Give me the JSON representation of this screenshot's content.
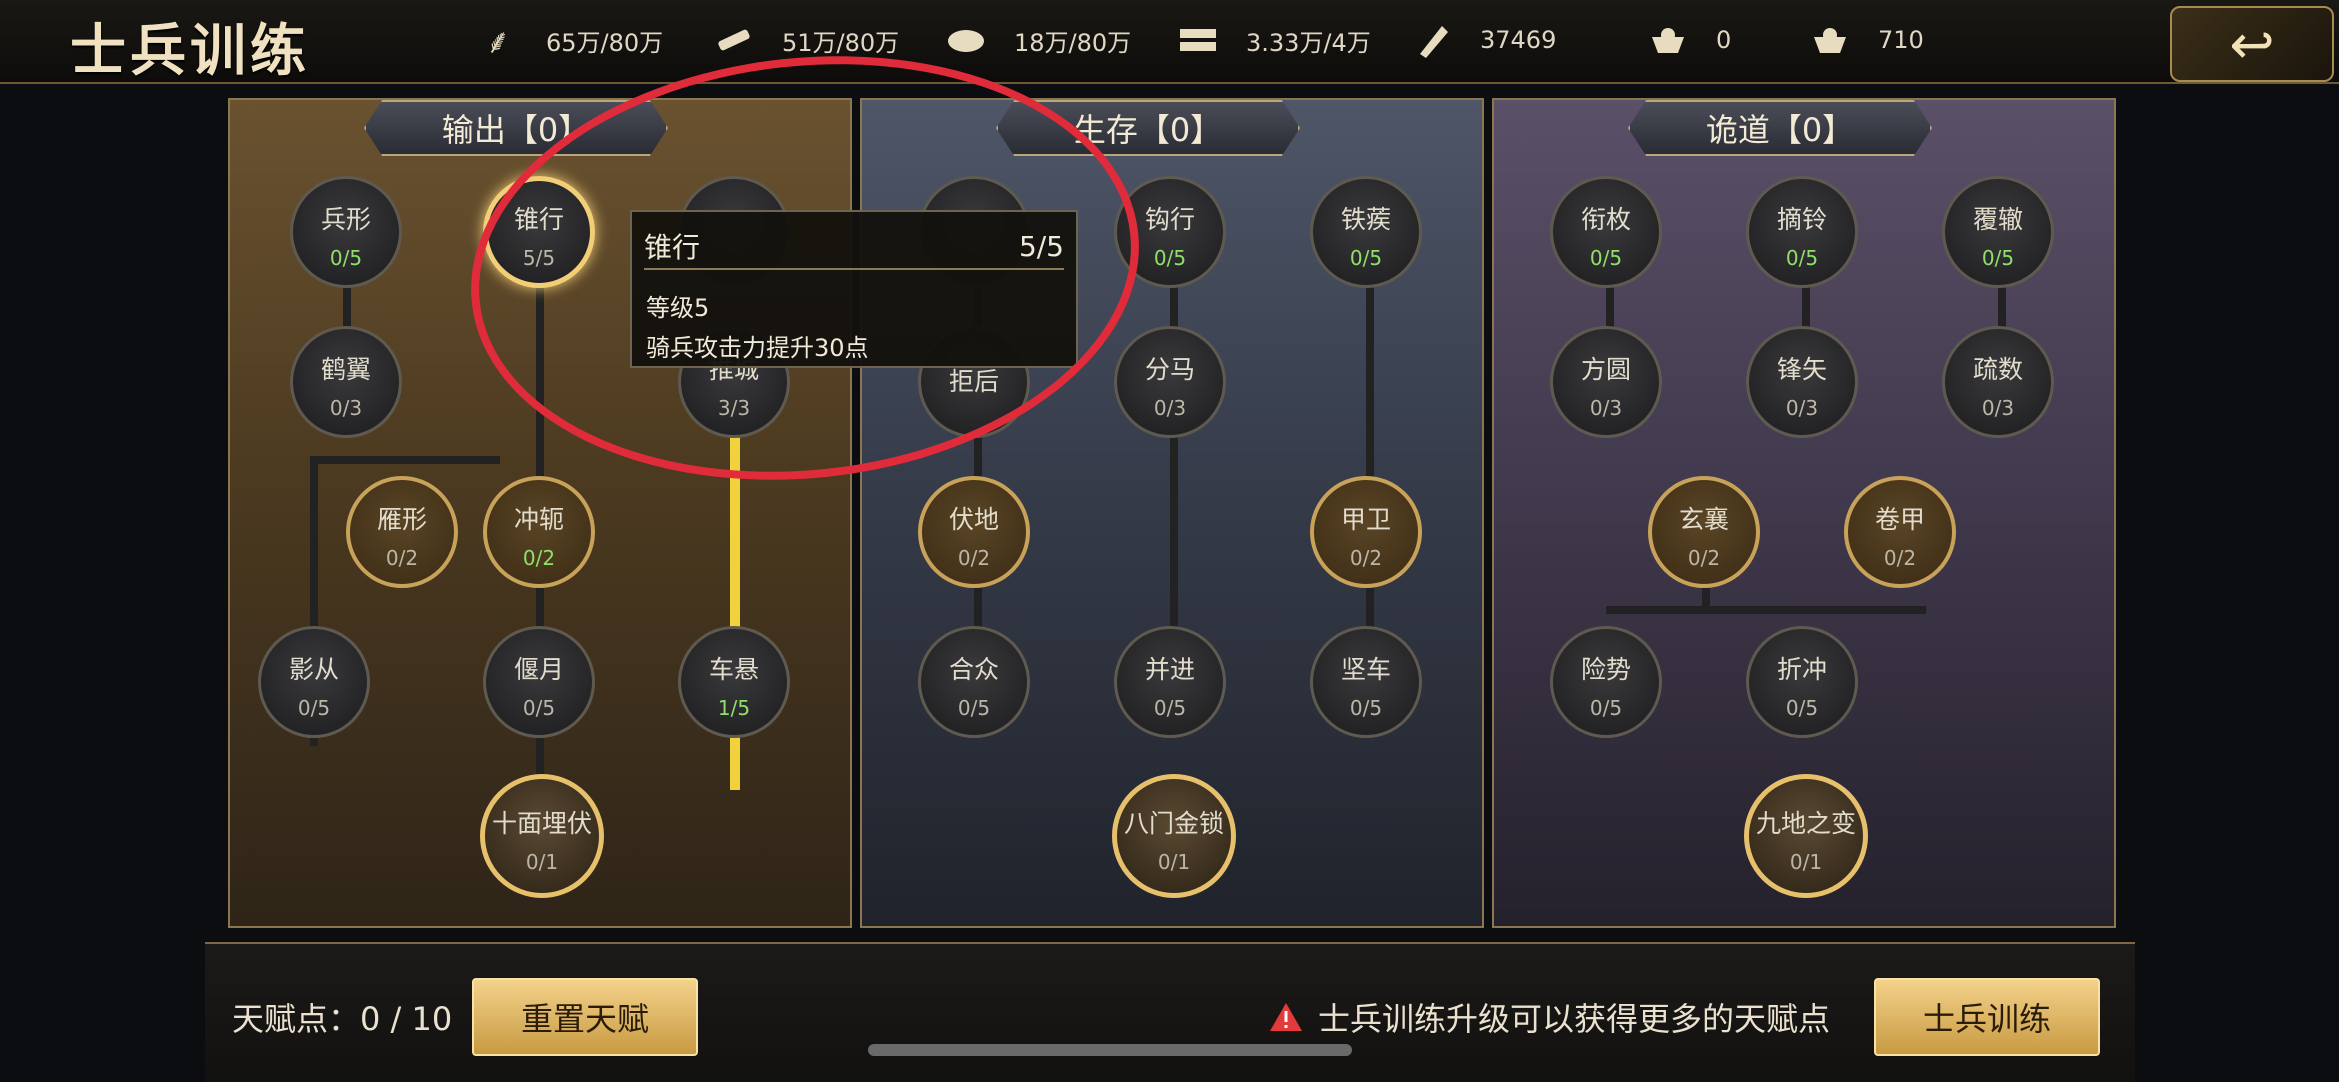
{
  "header": {
    "title": "士兵训练",
    "resources": [
      {
        "icon": "wheat-icon",
        "value": "65万/80万"
      },
      {
        "icon": "wood-icon",
        "value": "51万/80万"
      },
      {
        "icon": "stone-icon",
        "value": "18万/80万"
      },
      {
        "icon": "iron-icon",
        "value": "3.33万/4万"
      },
      {
        "icon": "order-icon",
        "value": "37469"
      },
      {
        "icon": "gold-ingot-icon",
        "value": "0"
      },
      {
        "icon": "silver-ingot-icon",
        "value": "710"
      }
    ],
    "back_icon": "back-arrow-icon"
  },
  "panels": [
    {
      "title": "输出【0】"
    },
    {
      "title": "生存【0】"
    },
    {
      "title": "诡道【0】"
    }
  ],
  "nodes": {
    "n1": {
      "name": "兵形",
      "level": "0/5"
    },
    "n2": {
      "name": "锥行",
      "level": "5/5"
    },
    "n3": {
      "name": "",
      "level": ""
    },
    "n4": {
      "name": "鹤翼",
      "level": "0/3"
    },
    "n5": {
      "name": "推城",
      "level": "3/3"
    },
    "n6": {
      "name": "雁形",
      "level": "0/2"
    },
    "n7": {
      "name": "冲轭",
      "level": "0/2"
    },
    "n8": {
      "name": "影从",
      "level": "0/5"
    },
    "n9": {
      "name": "偃月",
      "level": "0/5"
    },
    "n10": {
      "name": "车悬",
      "level": "1/5"
    },
    "n11": {
      "name": "十面埋伏",
      "level": "0/1"
    },
    "s1": {
      "name": "",
      "level": ""
    },
    "s2": {
      "name": "钩行",
      "level": "0/5"
    },
    "s3": {
      "name": "铁蒺",
      "level": "0/5"
    },
    "s4": {
      "name": "拒后",
      "level": ""
    },
    "s5": {
      "name": "分马",
      "level": "0/3"
    },
    "s6": {
      "name": "伏地",
      "level": "0/2"
    },
    "s7": {
      "name": "甲卫",
      "level": "0/2"
    },
    "s8": {
      "name": "合众",
      "level": "0/5"
    },
    "s9": {
      "name": "并进",
      "level": "0/5"
    },
    "s10": {
      "name": "坚车",
      "level": "0/5"
    },
    "s11": {
      "name": "八门金锁",
      "level": "0/1"
    },
    "g1": {
      "name": "衔枚",
      "level": "0/5"
    },
    "g2": {
      "name": "摘铃",
      "level": "0/5"
    },
    "g3": {
      "name": "覆辙",
      "level": "0/5"
    },
    "g4": {
      "name": "方圆",
      "level": "0/3"
    },
    "g5": {
      "name": "锋矢",
      "level": "0/3"
    },
    "g6": {
      "name": "疏数",
      "level": "0/3"
    },
    "g7": {
      "name": "玄襄",
      "level": "0/2"
    },
    "g8": {
      "name": "卷甲",
      "level": "0/2"
    },
    "g9": {
      "name": "险势",
      "level": "0/5"
    },
    "g10": {
      "name": "折冲",
      "level": "0/5"
    },
    "g11": {
      "name": "九地之变",
      "level": "0/1"
    }
  },
  "tooltip": {
    "name": "锥行",
    "level": "5/5",
    "line1": "等级5",
    "line2": "骑兵攻击力提升30点"
  },
  "footer": {
    "talent_points": "天赋点：0 / 10",
    "reset_button": "重置天赋",
    "warning_text": "士兵训练升级可以获得更多的天赋点",
    "train_button": "士兵训练"
  },
  "colors": {
    "gold": "#c9a25a",
    "highlight": "#f1d23c",
    "annotation": "#e02b3a",
    "active_level": "#8ee06a"
  }
}
